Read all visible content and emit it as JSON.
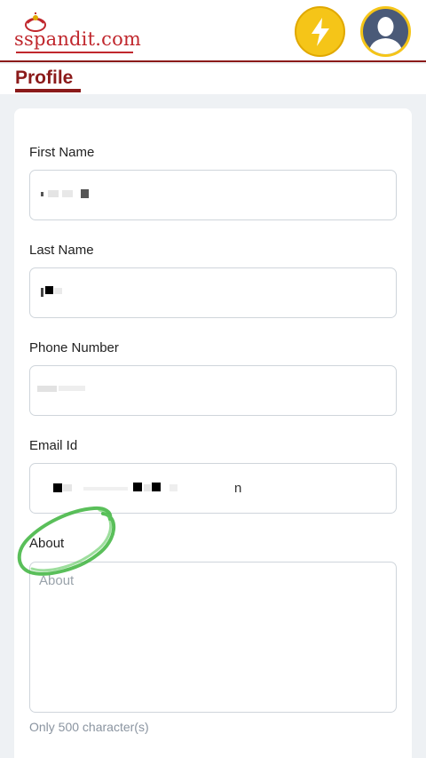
{
  "header": {
    "logo_text": "sspandit.com",
    "flash_icon": "lightning-icon",
    "avatar_icon": "user-avatar-icon"
  },
  "page": {
    "title": "Profile"
  },
  "form": {
    "first_name_label": "First Name",
    "first_name_value": "",
    "last_name_label": "Last Name",
    "last_name_value": "",
    "phone_label": "Phone Number",
    "phone_value": "",
    "email_label": "Email Id",
    "email_value": "",
    "email_suffix": "n",
    "about_label": "About",
    "about_placeholder": "About",
    "about_hint": "Only 500 character(s)"
  },
  "colors": {
    "brand": "#8b1a1a",
    "logo": "#c0272d",
    "flash": "#f5c518",
    "annotation": "#3db43d"
  }
}
